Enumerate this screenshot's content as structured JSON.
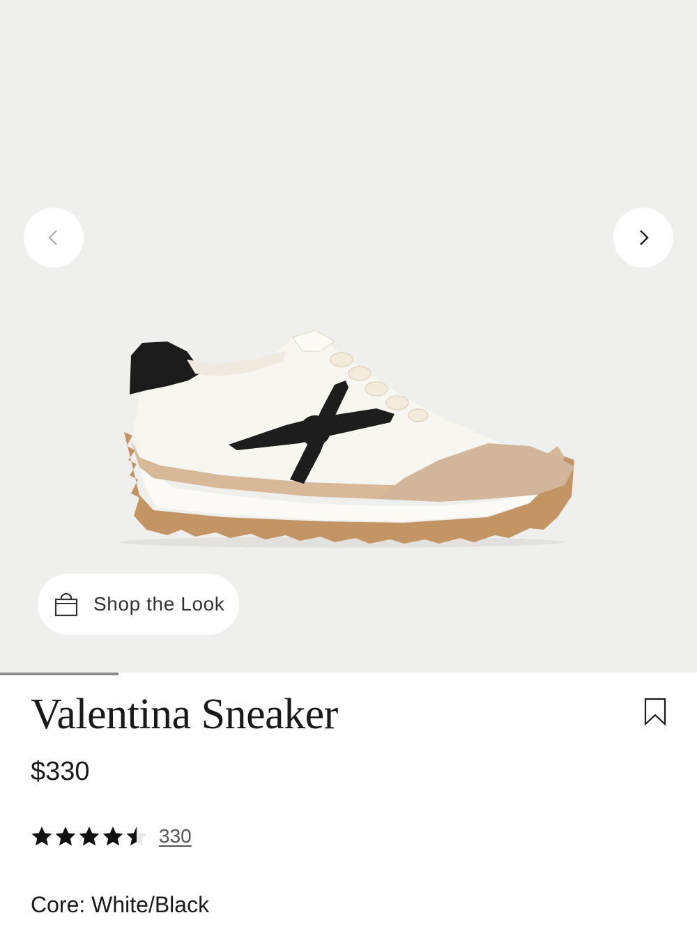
{
  "gallery": {
    "background": "#efefed",
    "prev_icon": "chevron-left-icon",
    "next_icon": "chevron-right-icon",
    "slide_progress": 0.17
  },
  "shop_the_look": {
    "label": "Shop the Look",
    "icon": "shopping-bag-icon"
  },
  "product": {
    "title": "Valentina Sneaker",
    "price": "$330",
    "rating": 4.5,
    "rating_max": 5,
    "review_count": "330",
    "color": "Core: White/Black",
    "bookmark_icon": "bookmark-icon"
  }
}
